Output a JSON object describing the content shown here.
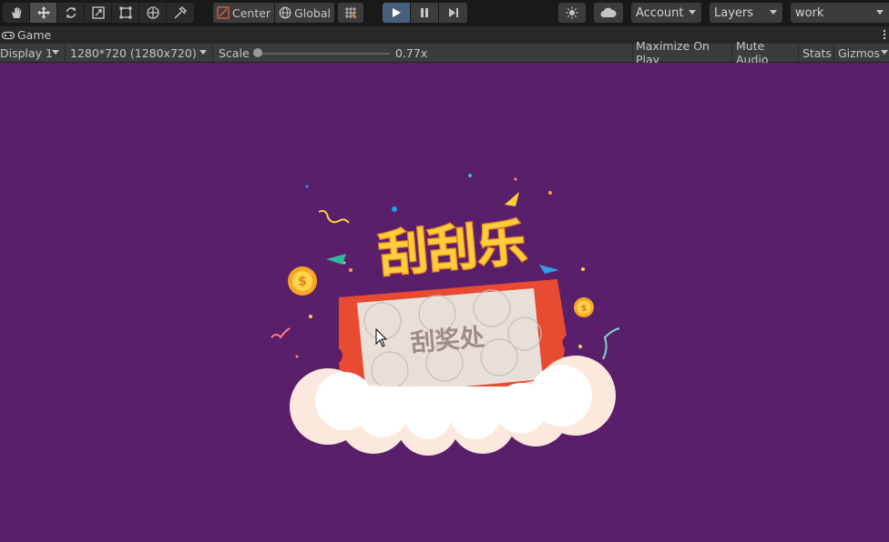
{
  "toolbar": {
    "tools": [
      "hand-tool",
      "move-tool",
      "rotate-tool",
      "scale-tool",
      "rect-tool",
      "transform-tool",
      "custom-tool"
    ],
    "active_tool": "move-tool",
    "pivot_label": "Center",
    "space_label": "Global",
    "account_label": "Account",
    "layers_label": "Layers",
    "layout_label": "work",
    "play_color": "#46607c"
  },
  "tab": {
    "label": "Game"
  },
  "gamebar": {
    "display": "Display 1",
    "resolution": "1280*720 (1280x720)",
    "scale_label": "Scale",
    "scale_value": "0.77x",
    "maximize": "Maximize On Play",
    "mute": "Mute Audio",
    "stats": "Stats",
    "gizmos": "Gizmos"
  },
  "scene": {
    "background": "#5a1f6b",
    "title": "刮刮乐",
    "card_text": "刮奖处",
    "coin_symbol": "$",
    "colors": {
      "ticket": "#e84a32",
      "title": "#ffcf3a",
      "cloud": "#ffffff",
      "card": "#e9dfd9"
    }
  }
}
